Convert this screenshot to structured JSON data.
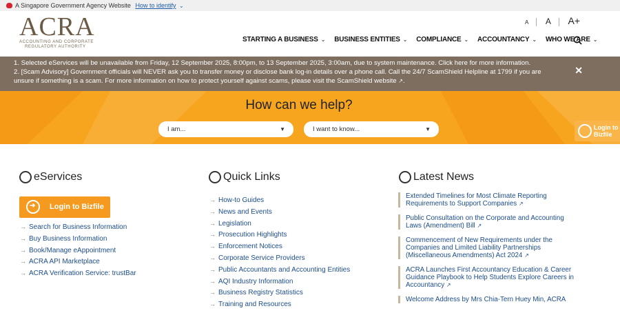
{
  "topbar": {
    "gov_text": "A Singapore Government Agency Website",
    "identify": "How to identify"
  },
  "logo": {
    "name": "ACRA",
    "line1": "Accounting and Corporate",
    "line2": "Regulatory Authority"
  },
  "text_size": [
    "A",
    "A",
    "A+"
  ],
  "nav": [
    "STARTING A BUSINESS",
    "BUSINESS ENTITIES",
    "COMPLIANCE",
    "ACCOUNTANCY",
    "WHO WE ARE"
  ],
  "alert": {
    "line1": "1. Selected eServices will be unavailable from Friday, 12 September 2025, 8:00pm, to 13 September 2025, 3:00am, due to system maintenance. Click here for more information.",
    "line2": "2. [Scam Advisory] Government officials will NEVER ask you to transfer money or disclose bank log-in details over a phone call. Call the 24/7 ScamShield Helpline at 1799 if you are",
    "line3": "unsure if something is a scam. For more information on how to protect yourself against scams, please visit the ScamShield website"
  },
  "hero": {
    "title": "How can we help?",
    "select1": "I am...",
    "select2": "I want to know...",
    "side_login_1": "Login to",
    "side_login_2": "Bizfile"
  },
  "eservices": {
    "title": "eServices",
    "login": "Login to Bizfile",
    "links": [
      "Search for Business Information",
      "Buy Business Information",
      "Book/Manage eAppointment",
      "ACRA API Marketplace",
      "ACRA Verification Service: trustBar"
    ]
  },
  "quick_links": {
    "title": "Quick Links",
    "links": [
      "How-to Guides",
      "News and Events",
      "Legislation",
      "Prosecution Highlights",
      "Enforcement Notices",
      "Corporate Service Providers",
      "Public Accountants and Accounting Entities",
      "AQI Industry Information",
      "Business Registry Statistics",
      "Training and Resources"
    ]
  },
  "latest_news": {
    "title": "Latest News",
    "items": [
      [
        "Extended Timelines for Most Climate Reporting",
        "Requirements to Support Companies"
      ],
      [
        "Public Consultation on the Corporate and Accounting",
        "Laws (Amendment) Bill"
      ],
      [
        "Commencement of New Requirements under the",
        "Companies and Limited Liability Partnerships",
        "(Miscellaneous Amendments) Act 2024"
      ],
      [
        "ACRA Launches First Accountancy Education & Career",
        "Guidance Playbook to Help Students Explore Careers in",
        "Accountancy"
      ],
      [
        "Welcome Address by Mrs Chia-Tern Huey Min, ACRA"
      ]
    ]
  },
  "colors": {
    "alert_bg": "#7d6e5f",
    "hero_bg": "#f7a51f",
    "link": "#1c4d8c",
    "button": "#f59a1e"
  }
}
